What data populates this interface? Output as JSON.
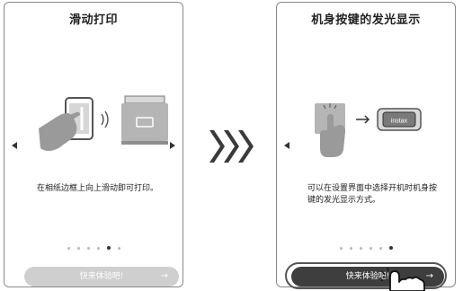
{
  "screens": [
    {
      "title": "滑动打印",
      "description": "在相纸边框上向上滑动即可打印。",
      "button_label": "快来体验吧!",
      "button_arrow": "→",
      "button_enabled": false,
      "page_dots": 6,
      "active_dot": 4
    },
    {
      "title": "机身按键的发光显示",
      "description": "可以在设置界面中选择开机时机身按键的发光显示方式。",
      "button_label": "快来体验吧!",
      "button_arrow": "→",
      "button_enabled": true,
      "page_dots": 6,
      "active_dot": 5,
      "device_label": "instax"
    }
  ],
  "colors": {
    "button_active": "#3e3e3e",
    "button_inactive": "#cfcfcf",
    "illustration_gray": "#9a9a9a"
  }
}
